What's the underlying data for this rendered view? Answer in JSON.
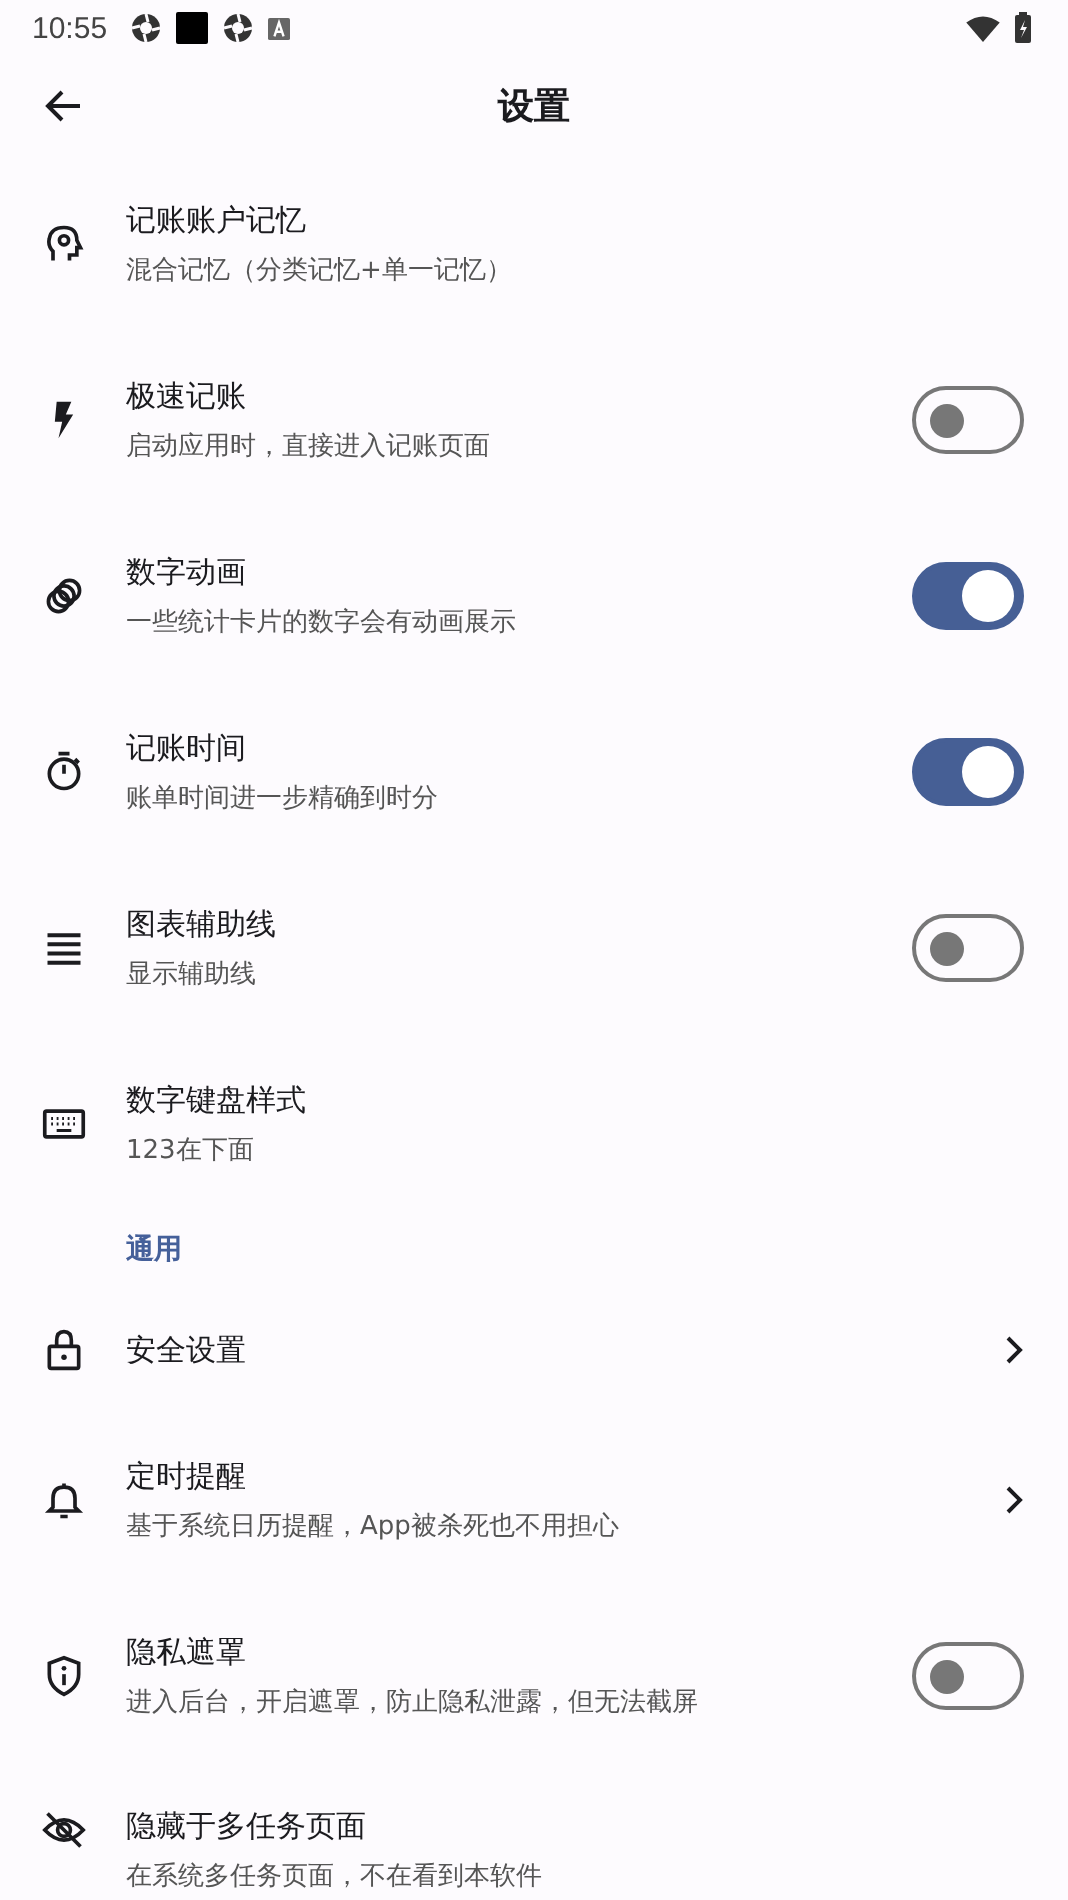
{
  "status_bar": {
    "time": "10:55"
  },
  "app_bar": {
    "title": "设置"
  },
  "items": [
    {
      "kind": "plain",
      "title": "记账账户记忆",
      "subtitle": "混合记忆（分类记忆+单一记忆）"
    },
    {
      "kind": "toggle",
      "title": "极速记账",
      "subtitle": "启动应用时，直接进入记账页面",
      "on": false
    },
    {
      "kind": "toggle",
      "title": "数字动画",
      "subtitle": "一些统计卡片的数字会有动画展示",
      "on": true
    },
    {
      "kind": "toggle",
      "title": "记账时间",
      "subtitle": "账单时间进一步精确到时分",
      "on": true
    },
    {
      "kind": "toggle",
      "title": "图表辅助线",
      "subtitle": "显示辅助线",
      "on": false
    },
    {
      "kind": "plain",
      "title": "数字键盘样式",
      "subtitle": "123在下面"
    },
    {
      "kind": "header",
      "title": "通用"
    },
    {
      "kind": "link",
      "title": "安全设置"
    },
    {
      "kind": "link",
      "title": "定时提醒",
      "subtitle": "基于系统日历提醒，App被杀死也不用担心"
    },
    {
      "kind": "toggle",
      "title": "隐私遮罩",
      "subtitle": "进入后台，开启遮罩，防止隐私泄露，但无法截屏",
      "on": false
    },
    {
      "kind": "plain",
      "title": "隐藏于多任务页面",
      "subtitle": "在系统多任务页面，不在看到本软件"
    }
  ]
}
